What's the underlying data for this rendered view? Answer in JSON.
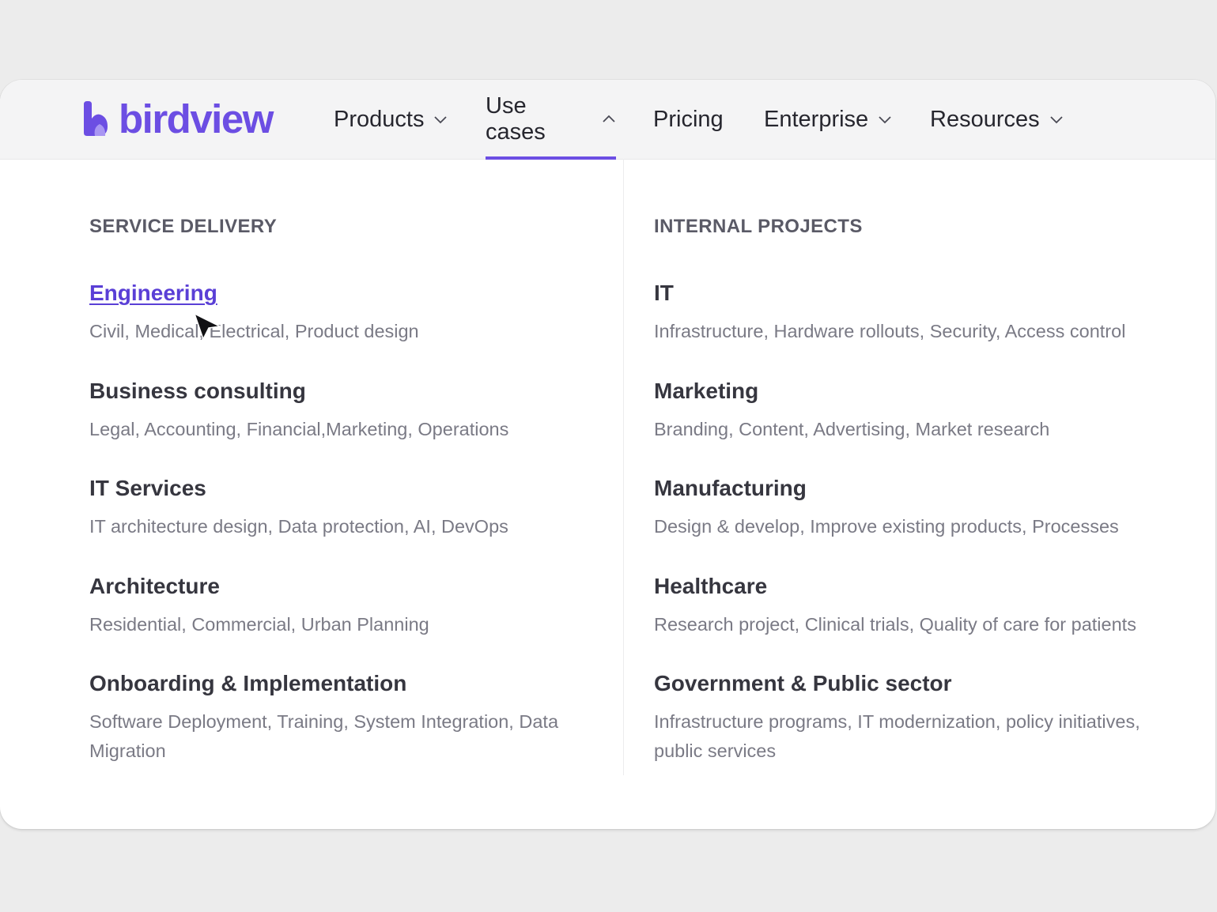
{
  "brand": {
    "name": "birdview",
    "color": "#6c4ee3"
  },
  "nav": {
    "items": [
      {
        "label": "Products",
        "has_dropdown": true,
        "expanded": false
      },
      {
        "label": "Use cases",
        "has_dropdown": true,
        "expanded": true,
        "active": true
      },
      {
        "label": "Pricing",
        "has_dropdown": false
      },
      {
        "label": "Enterprise",
        "has_dropdown": true,
        "expanded": false
      },
      {
        "label": "Resources",
        "has_dropdown": true,
        "expanded": false
      }
    ]
  },
  "menu": {
    "left": {
      "heading": "SERVICE DELIVERY",
      "entries": [
        {
          "title": "Engineering",
          "desc": "Civil, Medical, Electrical, Product design",
          "hovered": true
        },
        {
          "title": "Business consulting",
          "desc": "Legal, Accounting, Financial,Marketing, Operations"
        },
        {
          "title": "IT Services",
          "desc": "IT architecture design, Data protection, AI, DevOps"
        },
        {
          "title": "Architecture",
          "desc": "Residential, Commercial, Urban Planning"
        },
        {
          "title": "Onboarding & Implementation",
          "desc": "Software Deployment, Training, System Integration, Data Migration"
        }
      ]
    },
    "right": {
      "heading": "INTERNAL PROJECTS",
      "entries": [
        {
          "title": "IT",
          "desc": "Infrastructure, Hardware rollouts, Security, Access control"
        },
        {
          "title": "Marketing",
          "desc": "Branding, Content, Advertising, Market research"
        },
        {
          "title": "Manufacturing",
          "desc": "Design & develop, Improve existing products, Processes"
        },
        {
          "title": "Healthcare",
          "desc": "Research project, Clinical trials, Quality of care for patients"
        },
        {
          "title": "Government & Public sector",
          "desc": "Infrastructure programs, IT modernization, policy initiatives, public services"
        }
      ]
    }
  }
}
